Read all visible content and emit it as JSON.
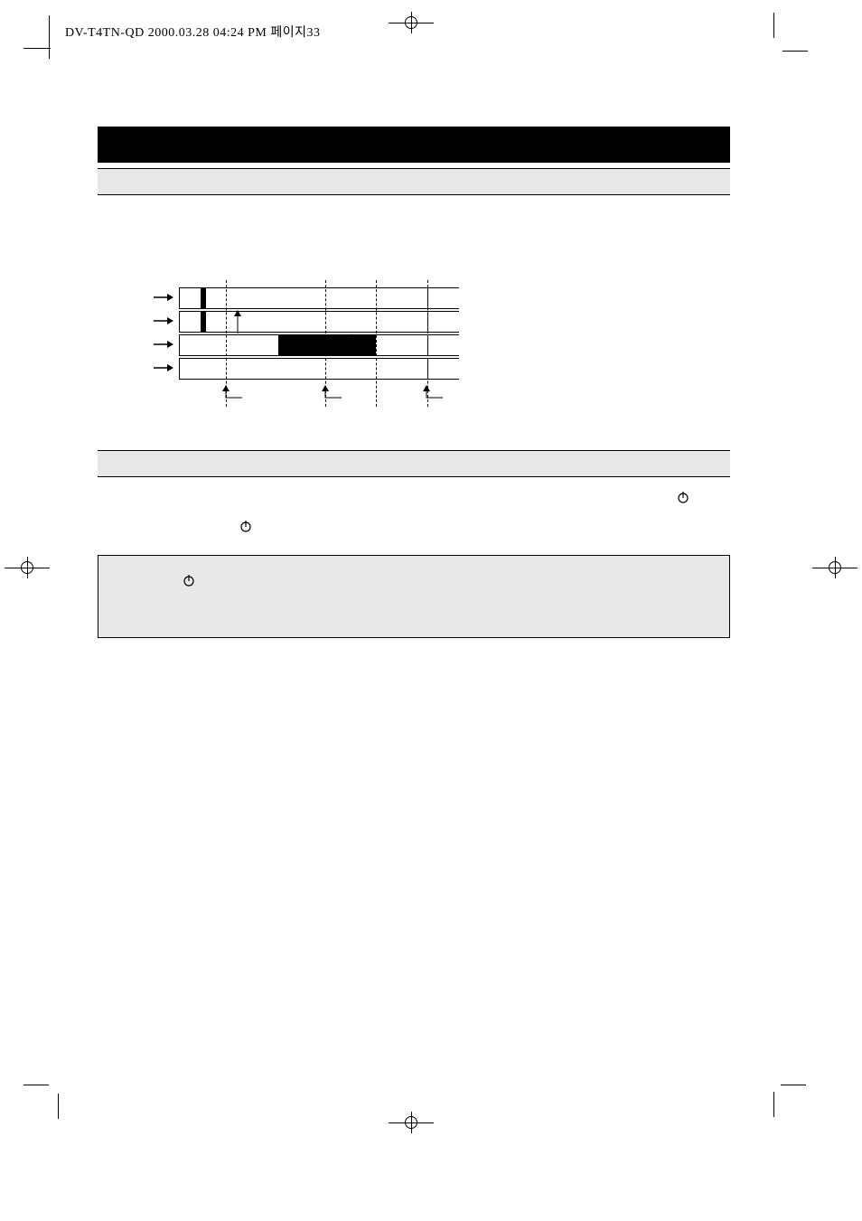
{
  "header": "DV-T4TN-QD  2000.03.28 04:24 PM 페이지33",
  "title_bar": "",
  "section_a": "",
  "body_above_diagram": "",
  "diagram": {
    "tracks": 4,
    "labels": {
      "t1": "",
      "t2": "",
      "t3": ""
    }
  },
  "section_b": "",
  "body_b_line1": "",
  "body_b_line2": "",
  "note_box": "",
  "icons": {
    "power": "power-icon"
  }
}
